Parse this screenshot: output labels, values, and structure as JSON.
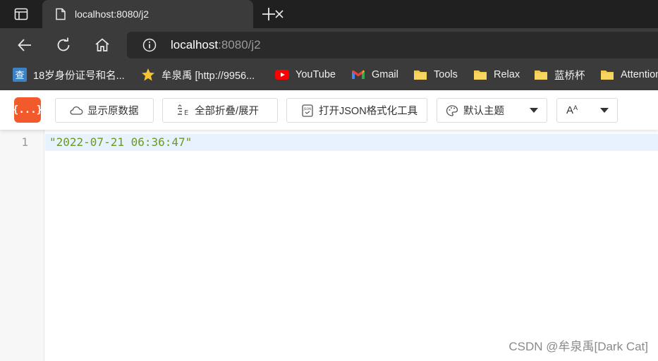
{
  "browser": {
    "tab": {
      "title": "localhost:8080/j2",
      "close": "close-tab"
    },
    "address": {
      "host": "localhost",
      "rest": ":8080/j2"
    }
  },
  "bookmarks": [
    {
      "label": "18岁身份证号和名...",
      "icon": "search-site-icon"
    },
    {
      "label": "牟泉禹 [http://9956...",
      "icon": "star-icon"
    },
    {
      "label": "YouTube",
      "icon": "youtube-icon"
    },
    {
      "label": "Gmail",
      "icon": "gmail-icon"
    },
    {
      "label": "Tools",
      "icon": "folder-icon"
    },
    {
      "label": "Relax",
      "icon": "folder-icon"
    },
    {
      "label": "蓝桥杯",
      "icon": "folder-icon"
    },
    {
      "label": "Attention",
      "icon": "folder-icon"
    }
  ],
  "viewer": {
    "logo": "{...}",
    "buttons": {
      "raw": "显示原数据",
      "fold": "全部折叠/展开",
      "tool": "打开JSON格式化工具",
      "theme": "默认主题",
      "font": "A"
    }
  },
  "editor": {
    "line_number": "1",
    "content": "\"2022-07-21 06:36:47\""
  },
  "watermark": "CSDN @牟泉禹[Dark Cat]",
  "colors": {
    "accent": "#f25a2b",
    "string": "#6a9a1f",
    "folder": "#f2c94c"
  }
}
